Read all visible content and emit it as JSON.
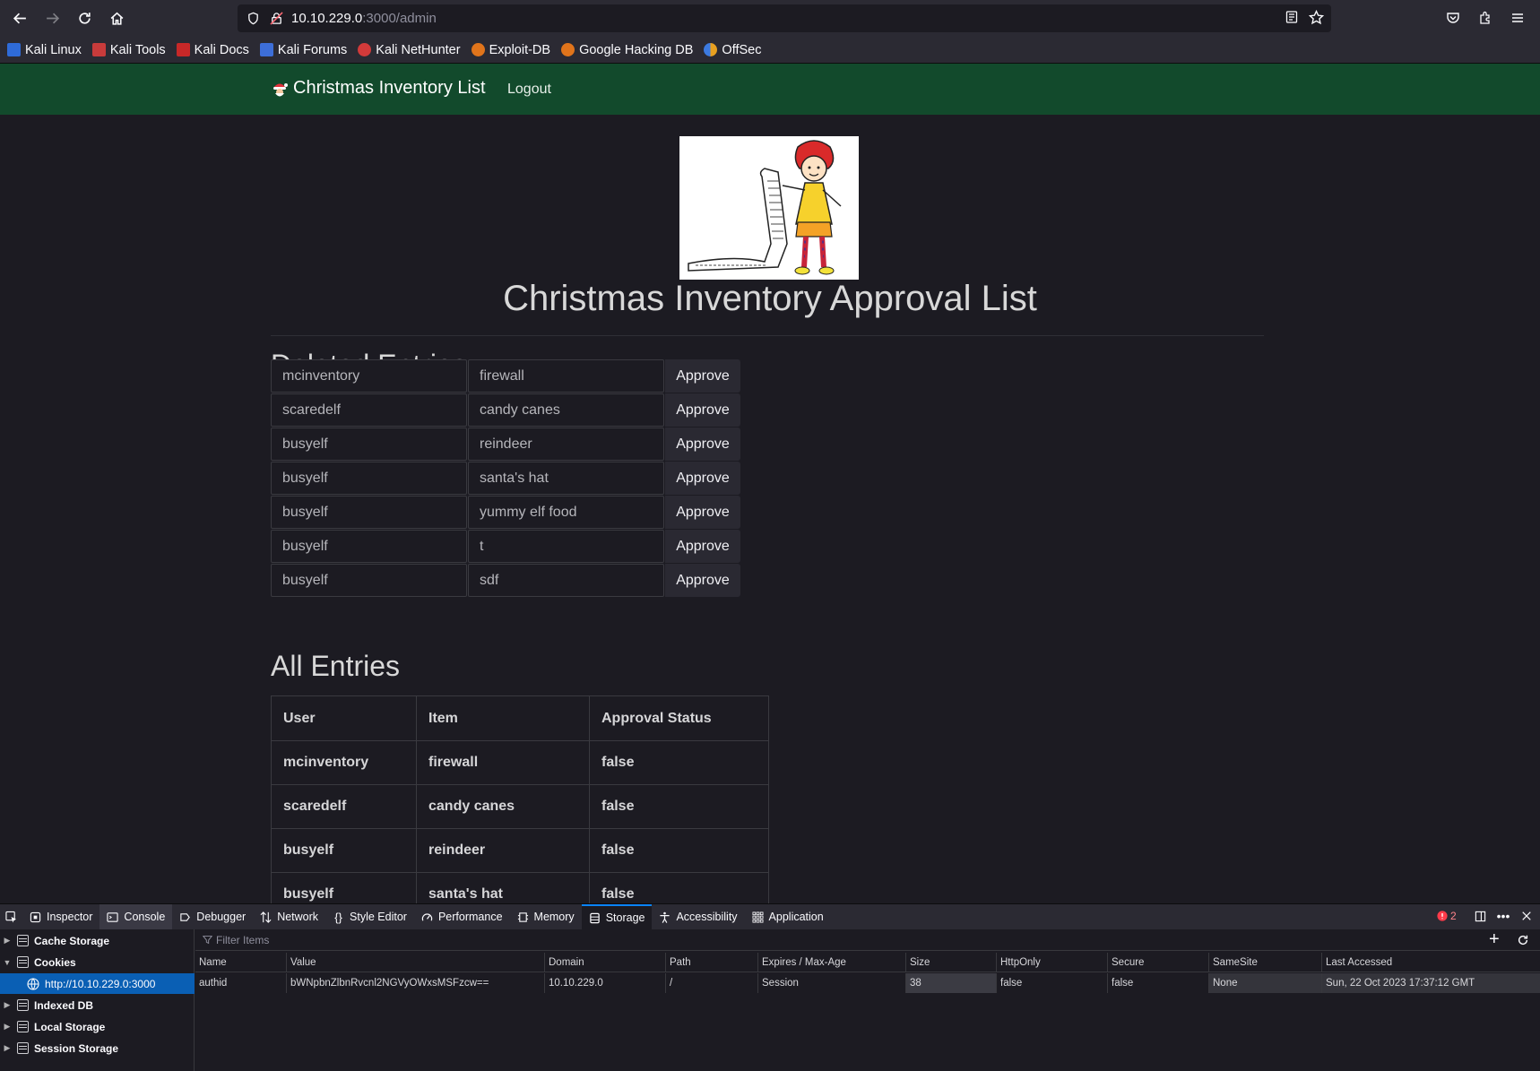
{
  "browser": {
    "url_host": "10.10.229.0",
    "url_path": ":3000/admin",
    "bookmarks": [
      "Kali Linux",
      "Kali Tools",
      "Kali Docs",
      "Kali Forums",
      "Kali NetHunter",
      "Exploit-DB",
      "Google Hacking DB",
      "OffSec"
    ]
  },
  "site": {
    "brand": "Christmas Inventory List",
    "logout": "Logout",
    "title": "Christmas Inventory Approval List",
    "deleted_heading": "Deleted Entries",
    "approve_label": "Approve",
    "deleted_entries": [
      {
        "user": "mcinventory",
        "item": "firewall"
      },
      {
        "user": "scaredelf",
        "item": "candy canes"
      },
      {
        "user": "busyelf",
        "item": "reindeer"
      },
      {
        "user": "busyelf",
        "item": "santa's hat"
      },
      {
        "user": "busyelf",
        "item": "yummy elf food"
      },
      {
        "user": "busyelf",
        "item": "t"
      },
      {
        "user": "busyelf",
        "item": "sdf"
      }
    ],
    "all_heading": "All Entries",
    "table_headers": {
      "user": "User",
      "item": "Item",
      "status": "Approval Status"
    },
    "all_entries": [
      {
        "user": "mcinventory",
        "item": "firewall",
        "status": "false"
      },
      {
        "user": "scaredelf",
        "item": "candy canes",
        "status": "false"
      },
      {
        "user": "busyelf",
        "item": "reindeer",
        "status": "false"
      },
      {
        "user": "busyelf",
        "item": "santa's hat",
        "status": "false"
      }
    ]
  },
  "devtools": {
    "tabs": [
      "Inspector",
      "Console",
      "Debugger",
      "Network",
      "Style Editor",
      "Performance",
      "Memory",
      "Storage",
      "Accessibility",
      "Application"
    ],
    "active_tab": "Storage",
    "error_count": "2",
    "sidebar": {
      "cache_storage": "Cache Storage",
      "cookies": "Cookies",
      "cookie_origin": "http://10.10.229.0:3000",
      "indexed_db": "Indexed DB",
      "local_storage": "Local Storage",
      "session_storage": "Session Storage"
    },
    "filter_placeholder": "Filter Items",
    "columns": [
      "Name",
      "Value",
      "Domain",
      "Path",
      "Expires / Max-Age",
      "Size",
      "HttpOnly",
      "Secure",
      "SameSite",
      "Last Accessed"
    ],
    "cookie": {
      "name": "authid",
      "value": "bWNpbnZlbnRvcnl2NGVyOWxsMSFzcw==",
      "domain": "10.10.229.0",
      "path": "/",
      "expires": "Session",
      "size": "38",
      "httponly": "false",
      "secure": "false",
      "samesite": "None",
      "last_accessed": "Sun, 22 Oct 2023 17:37:12 GMT"
    }
  }
}
